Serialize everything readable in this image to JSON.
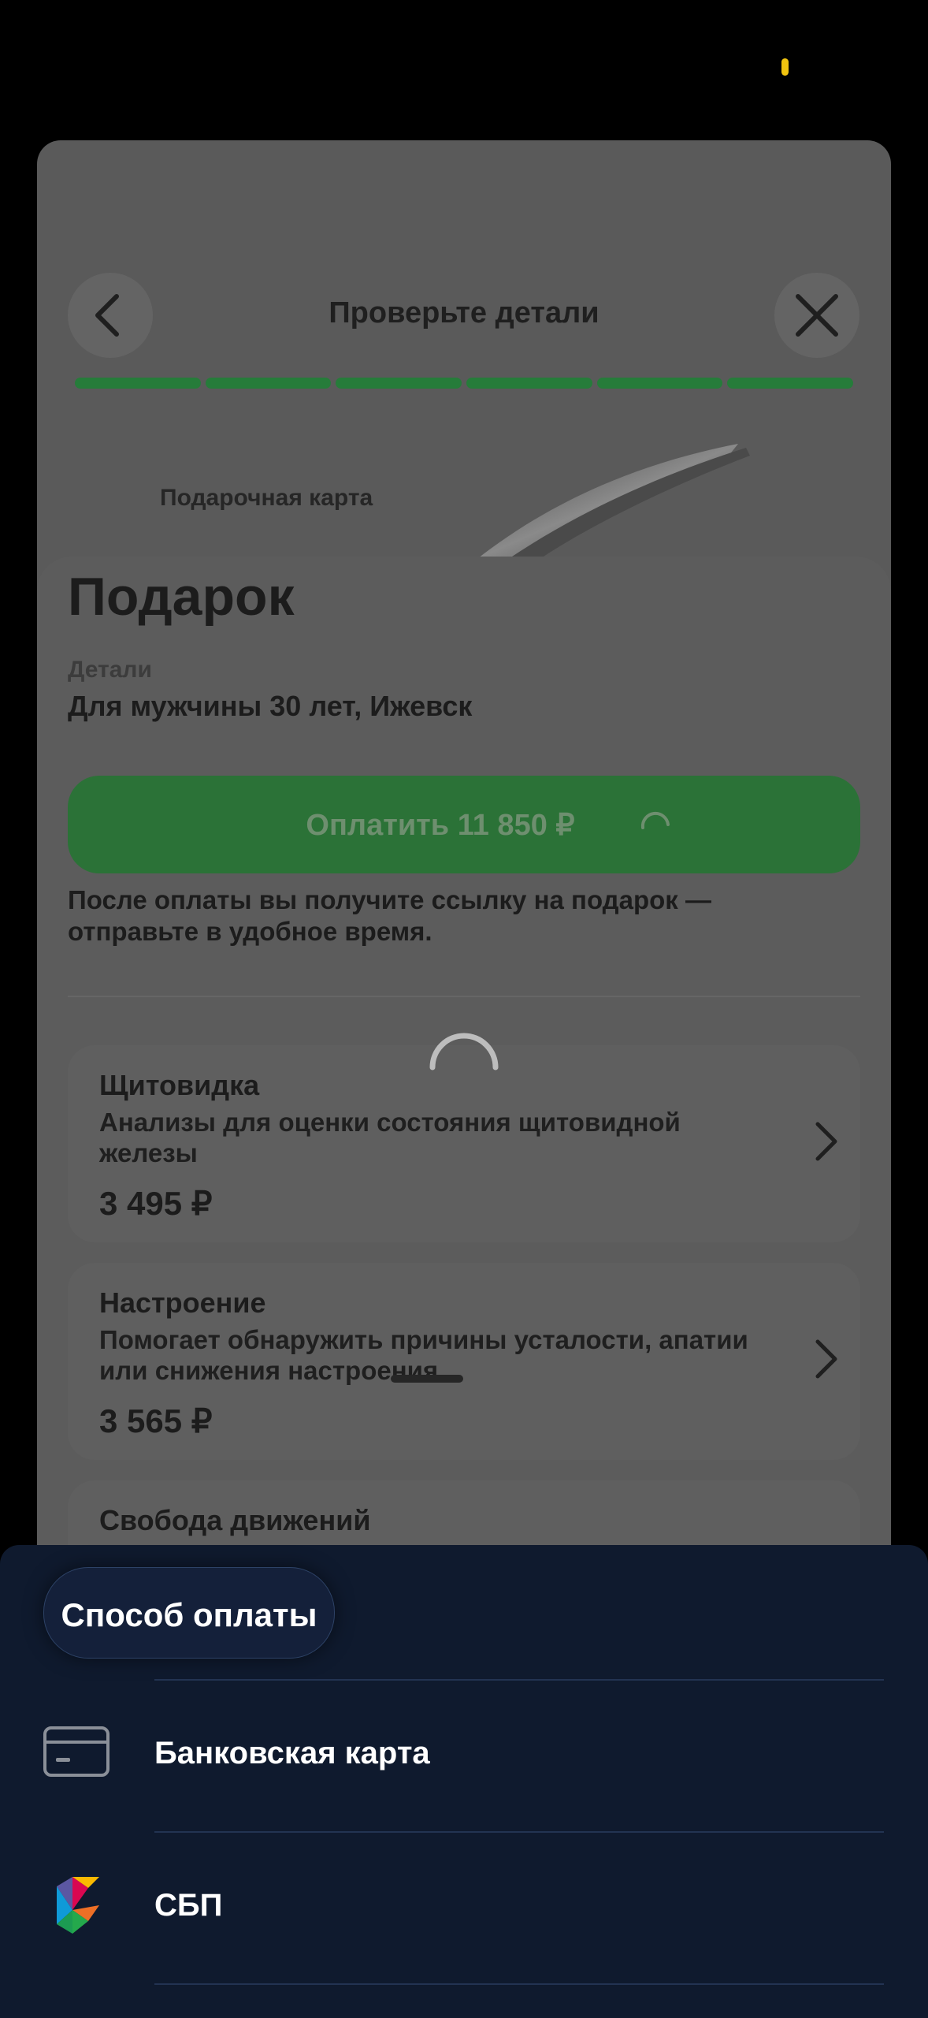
{
  "header": {
    "title": "Проверьте детали",
    "progress_segments_total": 6,
    "progress_segments_done": 6
  },
  "gift_card": {
    "label": "Подарочная карта"
  },
  "order": {
    "title": "Подарок",
    "details_label": "Детали",
    "details_value": "Для мужчины 30 лет, Ижевск",
    "pay_button_label": "Оплатить 11 850 ₽",
    "after_payment_note": "После оплаты вы получите ссылку на подарок — отправьте в удобное время."
  },
  "products": [
    {
      "title": "Щитовидка",
      "description": "Анализы для оценки состояния щитовидной железы",
      "price": "3 495 ₽"
    },
    {
      "title": "Настроение",
      "description": "Помогает обнаружить  причины усталости, апатии или снижения настроения",
      "price": "3 565 ₽"
    },
    {
      "title": "Свобода движений"
    }
  ],
  "payment_sheet": {
    "title": "Способ оплаты",
    "methods": [
      {
        "label": "Банковская карта",
        "icon": "bank-card-icon"
      },
      {
        "label": "СБП",
        "icon": "sbp-logo-icon"
      }
    ]
  },
  "colors": {
    "accent_green": "#267c3a",
    "sheet_bg": "#0f1a2e",
    "status_dot": "#f1c40f"
  }
}
